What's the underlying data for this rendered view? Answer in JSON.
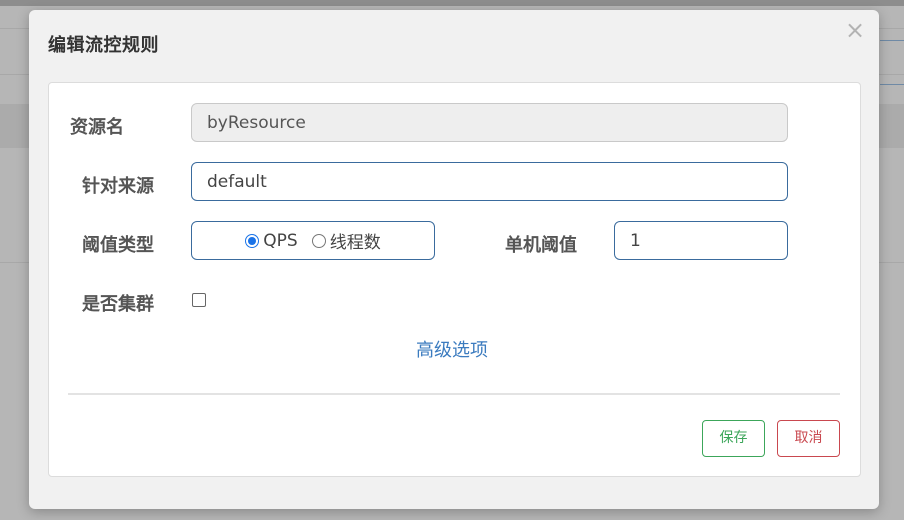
{
  "dialog": {
    "title": "编辑流控规则",
    "close_label": "×"
  },
  "form": {
    "resource_label": "资源名",
    "resource_value": "byResource",
    "limit_app_label": "针对来源",
    "limit_app_value": "default",
    "threshold_type_label": "阈值类型",
    "threshold_type_options": [
      {
        "label": "QPS",
        "checked": true
      },
      {
        "label": "线程数",
        "checked": false
      }
    ],
    "single_threshold_label": "单机阈值",
    "single_threshold_value": "1",
    "cluster_label": "是否集群",
    "cluster_checked": false,
    "advanced_link": "高级选项"
  },
  "footer": {
    "save_label": "保存",
    "cancel_label": "取消"
  },
  "colors": {
    "save": "#3ca65a",
    "cancel": "#c9484f",
    "link": "#3b7bbf",
    "input_border": "#3a6b9d",
    "radio_accent": "#1a73e8"
  }
}
